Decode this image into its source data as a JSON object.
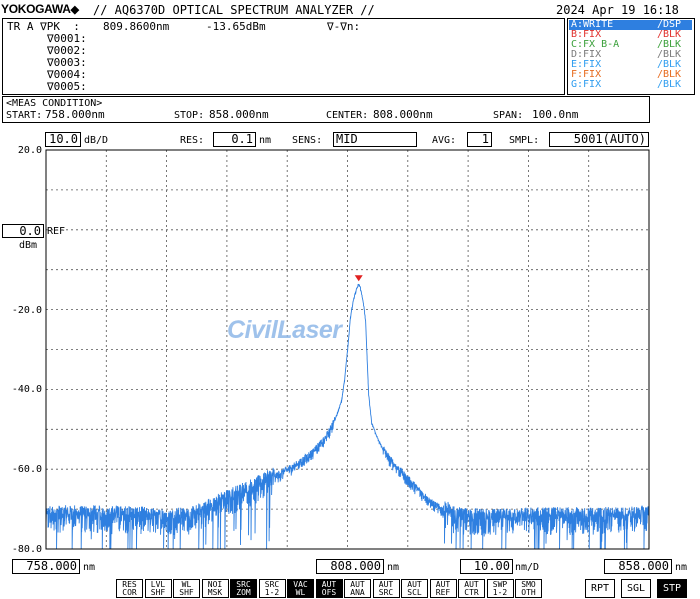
{
  "header": {
    "brand": "YOKOGAWA",
    "title": "// AQ6370D OPTICAL SPECTRUM ANALYZER //",
    "datetime": "2024 Apr 19 16:18"
  },
  "marker_panel": {
    "line1_label": "TR A ∇PK  :",
    "line1_wavelength": "809.8600nm",
    "line1_level": "-13.65dBm",
    "line1_delta": "∇-∇n:",
    "markers": [
      "∇0001:",
      "∇0002:",
      "∇0003:",
      "∇0004:",
      "∇0005:"
    ]
  },
  "traces": [
    {
      "name": "A:WRITE",
      "mode": "/DSP",
      "color": "#2e9df0",
      "selected": true
    },
    {
      "name": "B:FIX",
      "mode": "/BLK",
      "color": "#e0302c",
      "selected": false
    },
    {
      "name": "C:FX B-A",
      "mode": "/BLK",
      "color": "#3aa03a",
      "selected": false
    },
    {
      "name": "D:FIX",
      "mode": "/BLK",
      "color": "#7a7a7a",
      "selected": false
    },
    {
      "name": "E:FIX",
      "mode": "/BLK",
      "color": "#2e9df0",
      "selected": false
    },
    {
      "name": "F:FIX",
      "mode": "/BLK",
      "color": "#e86a1c",
      "selected": false
    },
    {
      "name": "G:FIX",
      "mode": "/BLK",
      "color": "#2e9df0",
      "selected": false
    }
  ],
  "meas_condition": {
    "title": "<MEAS CONDITION>",
    "start_label": "START:",
    "start_value": "758.000nm",
    "stop_label": "STOP:",
    "stop_value": "858.000nm",
    "center_label": "CENTER:",
    "center_value": "808.000nm",
    "span_label": "SPAN:",
    "span_value": "100.0nm"
  },
  "settings": {
    "scale_value": "10.0",
    "scale_unit": "dB/D",
    "res_label": "RES:",
    "res_value": "0.1",
    "res_unit": "nm",
    "sens_label": "SENS:",
    "sens_value": "MID",
    "avg_label": "AVG:",
    "avg_value": "1",
    "smpl_label": "SMPL:",
    "smpl_value": "5001(AUTO)"
  },
  "ref": {
    "value": "0.0",
    "label": "REF",
    "unit": "dBm"
  },
  "watermark": "CivilLaser",
  "bottom_axis": {
    "start": "758.000",
    "start_unit": "nm",
    "center": "808.000",
    "center_unit": "nm",
    "div": "10.00",
    "div_unit": "nm/D",
    "stop": "858.000",
    "stop_unit": "nm"
  },
  "softkeys": [
    {
      "top": "RES",
      "bottom": "COR",
      "active": false
    },
    {
      "top": "LVL",
      "bottom": "SHF",
      "active": false
    },
    {
      "top": "WL",
      "bottom": "SHF",
      "active": false
    },
    {
      "top": "NOI",
      "bottom": "MSK",
      "active": false
    },
    {
      "top": "SRC",
      "bottom": "ZOM",
      "active": true
    },
    {
      "top": "SRC",
      "bottom": "1-2",
      "active": false
    },
    {
      "top": "VAC",
      "bottom": "WL",
      "active": true
    },
    {
      "top": "AUT",
      "bottom": "OFS",
      "active": true
    },
    {
      "top": "AUT",
      "bottom": "ANA",
      "active": false
    },
    {
      "top": "AUT",
      "bottom": "SRC",
      "active": false
    },
    {
      "top": "AUT",
      "bottom": "SCL",
      "active": false
    },
    {
      "top": "AUT",
      "bottom": "REF",
      "active": false
    },
    {
      "top": "AUT",
      "bottom": "CTR",
      "active": false
    },
    {
      "top": "SWP",
      "bottom": "1-2",
      "active": false
    },
    {
      "top": "SMO",
      "bottom": "OTH",
      "active": false
    }
  ],
  "sweep_buttons": [
    {
      "label": "RPT",
      "active": false
    },
    {
      "label": "SGL",
      "active": false
    },
    {
      "label": "STP",
      "active": true
    }
  ],
  "chart_data": {
    "type": "line",
    "title": "",
    "xlabel": "",
    "ylabel": "",
    "xlim": [
      758.0,
      858.0
    ],
    "ylim": [
      -80.0,
      20.0
    ],
    "x_unit": "nm",
    "y_unit": "dBm",
    "y_tick_labels": [
      "20.0",
      "-20.0",
      "-40.0",
      "-60.0",
      "-80.0"
    ],
    "y_ticks": [
      20,
      -20,
      -40,
      -60,
      -80
    ],
    "grid": true,
    "series": [
      {
        "color": "#2e7fe0",
        "x": [
          758,
          764,
          770,
          776,
          782,
          788,
          794,
          797,
          800,
          802,
          804,
          805,
          806,
          807,
          807.5,
          808,
          808.5,
          809,
          809.5,
          809.86,
          810.2,
          810.7,
          811,
          811.5,
          812,
          813,
          814,
          815,
          818,
          822,
          826,
          832,
          838,
          844,
          850,
          858
        ],
        "y": [
          -72.5,
          -72.5,
          -72.5,
          -73,
          -73,
          -68.5,
          -64.5,
          -61.5,
          -59,
          -56.5,
          -53.5,
          -51,
          -47.5,
          -43,
          -38,
          -30.5,
          -22,
          -17.5,
          -15,
          -13.65,
          -15,
          -19,
          -23,
          -41,
          -48.5,
          -52.5,
          -55.5,
          -58,
          -63,
          -69,
          -73,
          -73.5,
          -73,
          -73,
          -73,
          -72.5
        ]
      }
    ],
    "peak_marker": {
      "x": 809.86,
      "y": -13.65
    }
  }
}
